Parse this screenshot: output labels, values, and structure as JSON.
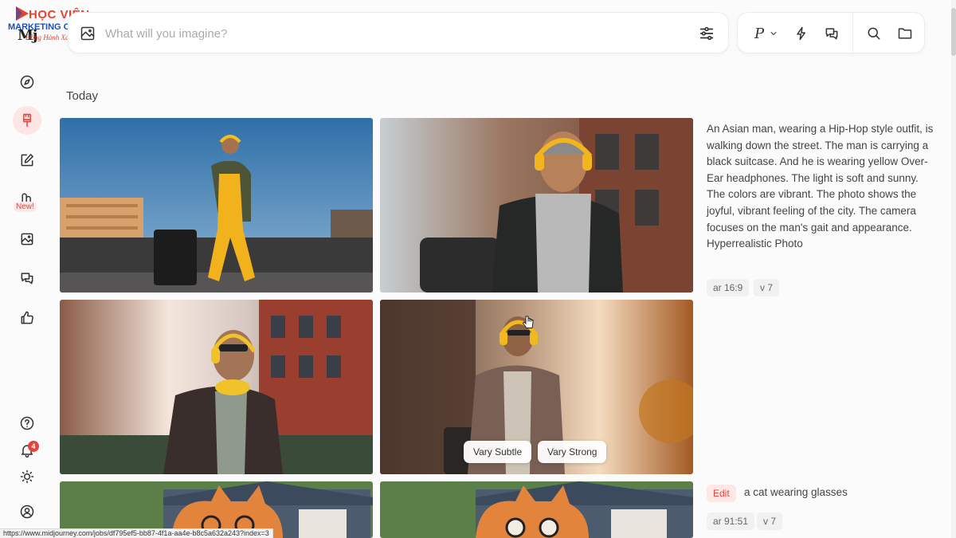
{
  "watermark": {
    "title": "HỌC VIỆN",
    "subtitle": "MARKETING ONLINE",
    "tagline": "Đồng Hành Xa Cùng Bạn"
  },
  "brand": {
    "name": "Mj"
  },
  "sidebar": {
    "items": [
      {
        "name": "explore",
        "icon": "compass-icon"
      },
      {
        "name": "create",
        "icon": "brush-icon",
        "active": true
      },
      {
        "name": "edit",
        "icon": "edit-icon"
      },
      {
        "name": "personalize",
        "icon": "moodboard-icon",
        "badge": "New!"
      },
      {
        "name": "organize",
        "icon": "image-icon"
      },
      {
        "name": "chat",
        "icon": "chat-icon"
      },
      {
        "name": "rank",
        "icon": "thumbs-up-icon"
      }
    ],
    "bottom": [
      {
        "name": "help",
        "icon": "help-icon"
      },
      {
        "name": "notifications",
        "icon": "bell-icon",
        "count": "4"
      },
      {
        "name": "theme",
        "icon": "sun-icon"
      },
      {
        "name": "account",
        "icon": "user-icon"
      }
    ]
  },
  "search": {
    "placeholder": "What will you imagine?",
    "value": ""
  },
  "toolbar": {
    "personalize_label": "P"
  },
  "section": {
    "title": "Today"
  },
  "job1": {
    "prompt": "An Asian man, wearing a Hip-Hop style outfit, is walking down the street. The man is carrying a black suitcase. And he is wearing yellow Over-Ear headphones. The light is soft and sunny. The colors are vibrant. The photo shows the joyful, vibrant feeling of the city. The camera focuses on the man's gait and appearance. Hyperrealistic Photo",
    "chips": [
      "ar 16:9",
      "v 7"
    ],
    "vary_subtle": "Vary Subtle",
    "vary_strong": "Vary Strong"
  },
  "job2": {
    "edit_label": "Edit",
    "prompt": "a cat wearing glasses",
    "chips": [
      "ar 91:51",
      "v 7"
    ]
  },
  "status_url": "https://www.midjourney.com/jobs/df795ef5-bb87-4f1a-aa4e-b8c5a632a243?index=3",
  "colors": {
    "accent": "#e0463f",
    "background": "#fbfbfb"
  }
}
